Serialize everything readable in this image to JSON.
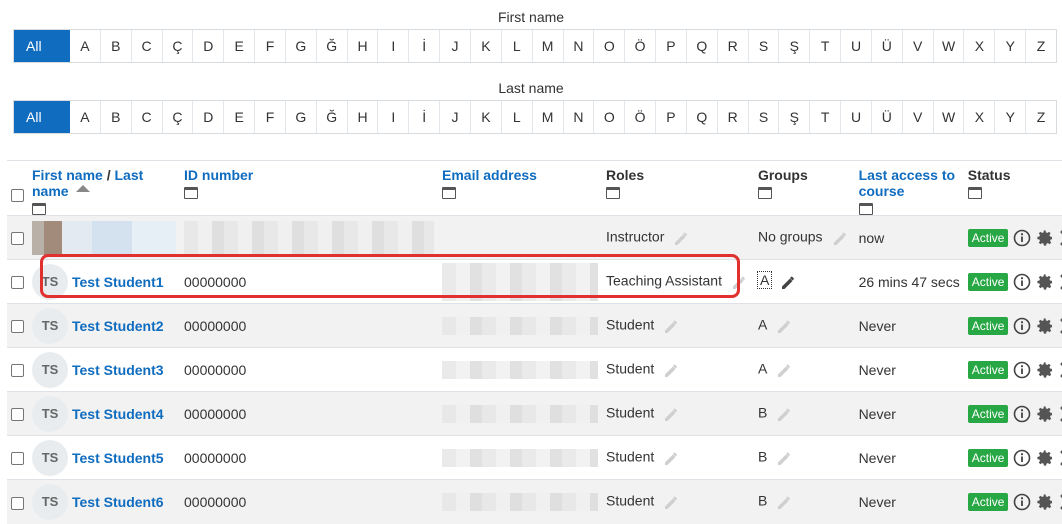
{
  "first_name_filter": {
    "label": "First name",
    "letters": [
      "All",
      "A",
      "B",
      "C",
      "Ç",
      "D",
      "E",
      "F",
      "G",
      "Ğ",
      "H",
      "I",
      "İ",
      "J",
      "K",
      "L",
      "M",
      "N",
      "O",
      "Ö",
      "P",
      "Q",
      "R",
      "S",
      "Ş",
      "T",
      "U",
      "Ü",
      "V",
      "W",
      "X",
      "Y",
      "Z"
    ],
    "selected": "All"
  },
  "last_name_filter": {
    "label": "Last name",
    "letters": [
      "All",
      "A",
      "B",
      "C",
      "Ç",
      "D",
      "E",
      "F",
      "G",
      "Ğ",
      "H",
      "I",
      "İ",
      "J",
      "K",
      "L",
      "M",
      "N",
      "O",
      "Ö",
      "P",
      "Q",
      "R",
      "S",
      "Ş",
      "T",
      "U",
      "Ü",
      "V",
      "W",
      "X",
      "Y",
      "Z"
    ],
    "selected": "All"
  },
  "table": {
    "headers": {
      "first_name": "First name",
      "separator": " / ",
      "last_name": "Last name",
      "id_number": "ID number",
      "email": "Email address",
      "roles": "Roles",
      "groups": "Groups",
      "last_access": "Last access to course",
      "status": "Status"
    },
    "rows": [
      {
        "initials": "",
        "name": "",
        "id": "",
        "role": "Instructor",
        "group": "No groups",
        "last_access": "now",
        "status": "Active"
      },
      {
        "initials": "TS",
        "name": "Test Student1",
        "id": "00000000",
        "role": "Teaching Assistant",
        "group": "A",
        "last_access": "26 mins 47 secs",
        "status": "Active"
      },
      {
        "initials": "TS",
        "name": "Test Student2",
        "id": "00000000",
        "role": "Student",
        "group": "A",
        "last_access": "Never",
        "status": "Active"
      },
      {
        "initials": "TS",
        "name": "Test Student3",
        "id": "00000000",
        "role": "Student",
        "group": "A",
        "last_access": "Never",
        "status": "Active"
      },
      {
        "initials": "TS",
        "name": "Test Student4",
        "id": "00000000",
        "role": "Student",
        "group": "B",
        "last_access": "Never",
        "status": "Active"
      },
      {
        "initials": "TS",
        "name": "Test Student5",
        "id": "00000000",
        "role": "Student",
        "group": "B",
        "last_access": "Never",
        "status": "Active"
      },
      {
        "initials": "TS",
        "name": "Test Student6",
        "id": "00000000",
        "role": "Student",
        "group": "B",
        "last_access": "Never",
        "status": "Active"
      }
    ]
  },
  "colors": {
    "accent": "#0f6cbf",
    "active_badge": "#28a745",
    "highlight": "#e0312e"
  },
  "icons": {
    "sort": "sort-ascending-icon",
    "collapse": "collapse-column-icon",
    "edit": "pencil-icon",
    "info": "info-icon",
    "settings": "gear-icon",
    "remove": "close-icon"
  }
}
